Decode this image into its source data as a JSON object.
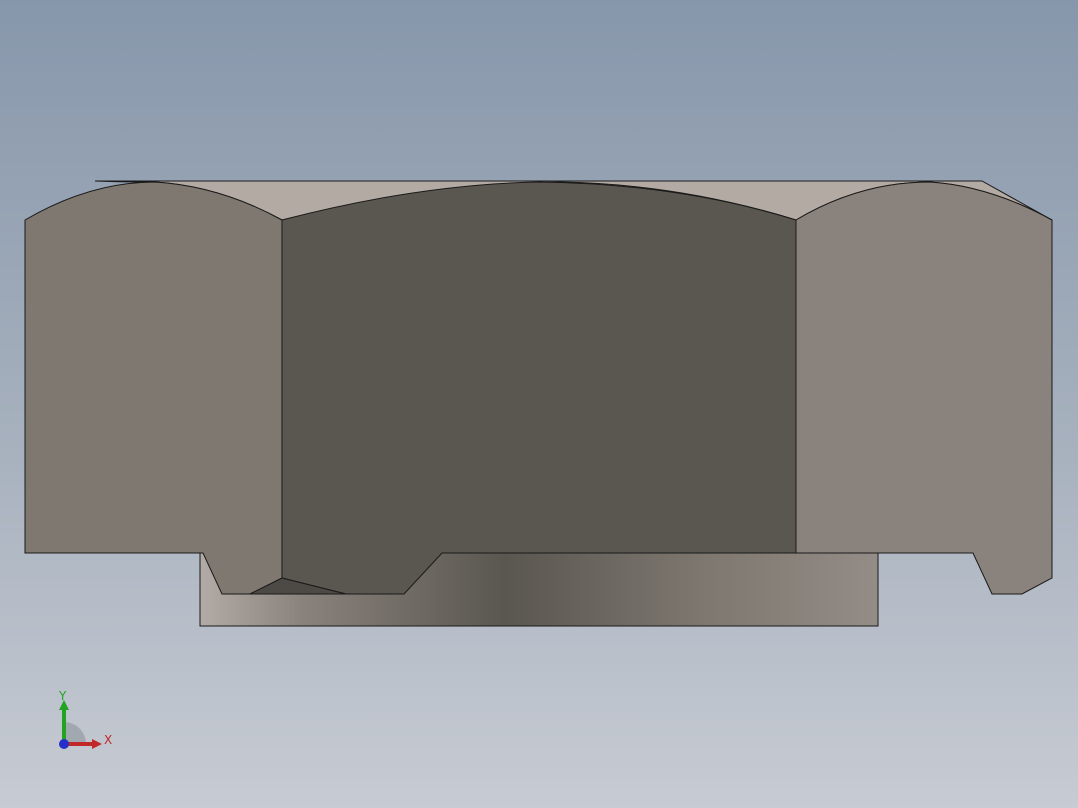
{
  "viewport": {
    "background_top": "#8797ab",
    "background_bottom": "#c7cbd3"
  },
  "model": {
    "face_left_color": "#7e7870",
    "face_center_color": "#5a5650",
    "face_right_color": "#8a827c",
    "top_chamfer_color": "#b4aaa4",
    "edge_color": "#1a1a1a"
  },
  "triad": {
    "x_label": "X",
    "y_label": "Y",
    "x_color": "#c0282a",
    "y_color": "#22a322",
    "z_color": "#2430c8"
  }
}
